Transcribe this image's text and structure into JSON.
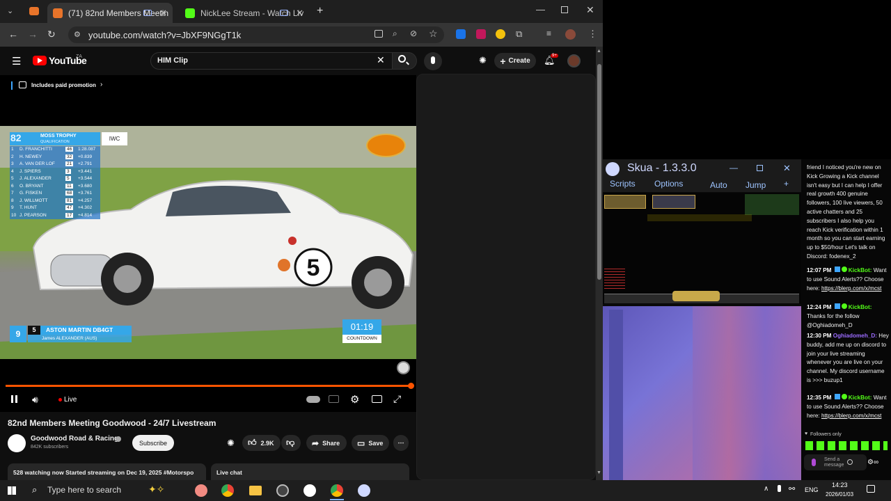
{
  "browser": {
    "tabs": [
      {
        "label": "(71) 82nd Members Meetin",
        "active": true
      },
      {
        "label": "NickLee Stream - Watch Liv",
        "active": false
      }
    ],
    "url": "youtube.com/watch?v=JbXF9NGgT1k"
  },
  "youtube": {
    "logo_text": "YouTube",
    "country_code": "ZA",
    "search_value": "HIM Clip",
    "create_label": "Create",
    "notification_count": "9+",
    "paid_promotion": "Includes paid promotion",
    "player": {
      "status": "Live",
      "overlay": {
        "leaderboard_title": "MOSS TROPHY",
        "leaderboard_subtitle": "QUALIFICATION",
        "sponsor_box": "IWC",
        "rows": [
          {
            "pos": "1",
            "driver": "D. FRANCHITTI",
            "num": "46",
            "gap": "1:28.087"
          },
          {
            "pos": "2",
            "driver": "H. NEWEY",
            "num": "32",
            "gap": "+0.839"
          },
          {
            "pos": "3",
            "driver": "A. VAN DER LOF",
            "num": "21",
            "gap": "+2.791"
          },
          {
            "pos": "4",
            "driver": "J. SPIERS",
            "num": "3",
            "gap": "+3.441"
          },
          {
            "pos": "5",
            "driver": "J. ALEXANDER",
            "num": "5",
            "gap": "+3.544"
          },
          {
            "pos": "6",
            "driver": "O. BRYANT",
            "num": "11",
            "gap": "+3.680"
          },
          {
            "pos": "7",
            "driver": "G. FISKEN",
            "num": "68",
            "gap": "+3.761"
          },
          {
            "pos": "8",
            "driver": "J. WILLMOTT",
            "num": "81",
            "gap": "+4.257"
          },
          {
            "pos": "9",
            "driver": "T. HUNT",
            "num": "47",
            "gap": "+4.302"
          },
          {
            "pos": "10",
            "driver": "J. PEARSON",
            "num": "17",
            "gap": "+4.814"
          }
        ],
        "lower_third": {
          "position": "9",
          "car_number": "5",
          "car_name": "ASTON MARTIN DB4GT",
          "driver": "James ALEXANDER (AUS)"
        },
        "countdown_time": "01:19",
        "countdown_label": "COUNTDOWN",
        "car_number_on_door": "5"
      }
    },
    "video_title": "82nd Members Meeting Goodwood - 24/7 Livestream",
    "channel_name": "Goodwood Road & Racing",
    "subscriber_count": "842K subscribers",
    "subscribe_label": "Subscribe",
    "like_count": "2.9K",
    "share_label": "Share",
    "save_label": "Save",
    "description_line": "528 watching now  Started streaming on Dec 19, 2025  #Motorspo",
    "live_chat_label": "Live chat"
  },
  "skua": {
    "title": "Skua - 1.3.3.0",
    "menu": [
      "Scripts",
      "Options",
      "Auto",
      "Jump",
      "+"
    ]
  },
  "chat": {
    "messages": [
      {
        "time": "",
        "user": "",
        "text": "friend I noticed you're new on Kick Growing a Kick channel isn't easy but I can help I offer real growth 400 genuine followers, 100 live viewers, 50 active chatters and 25 subscribers I also help you reach Kick verification within 1 month so you can start earning up to $50/hour Let's talk on Discord: fodenex_2",
        "link": ""
      },
      {
        "time": "12:07 PM",
        "user": "KickBot:",
        "text": "Want to use Sound Alerts?? Choose here:",
        "link": "https://blerp.com/x/mcst"
      },
      {
        "time": "12:24 PM",
        "user": "KickBot:",
        "text": "Thanks for the follow @Oghiadomeh_D",
        "link": ""
      },
      {
        "time": "12:30 PM",
        "user": "Oghiadomeh_D:",
        "text": "Hey buddy, add me up on discord to join your live streaming whenever you are live on your channel. My discord username is >>> buzup1",
        "link": ""
      },
      {
        "time": "12:35 PM",
        "user": "KickBot:",
        "text": "Want to use Sound Alerts?? Choose here:",
        "link": "https://blerp.com/x/mcst"
      }
    ],
    "followers_only": "Followers only",
    "input_placeholder": "Send a message"
  },
  "taskbar": {
    "search_placeholder": "Type here to search",
    "language": "ENG",
    "time": "14:23",
    "date": "2026/01/03"
  }
}
